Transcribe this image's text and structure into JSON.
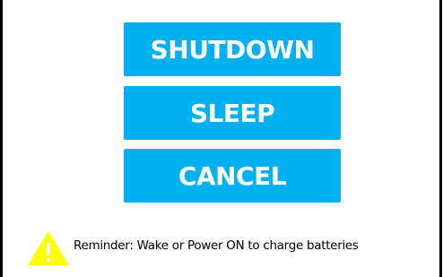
{
  "dialog": {
    "buttons": {
      "shutdown_label": "SHUTDOWN",
      "sleep_label": "SLEEP",
      "cancel_label": "CANCEL"
    },
    "reminder": {
      "icon": "warning-triangle-icon",
      "text": "Reminder: Wake or Power ON to charge batteries"
    }
  },
  "colors": {
    "button_background": "#00b0f0",
    "button_text": "#ffffff",
    "warning_icon": "#ffff00",
    "border": "#000000"
  }
}
